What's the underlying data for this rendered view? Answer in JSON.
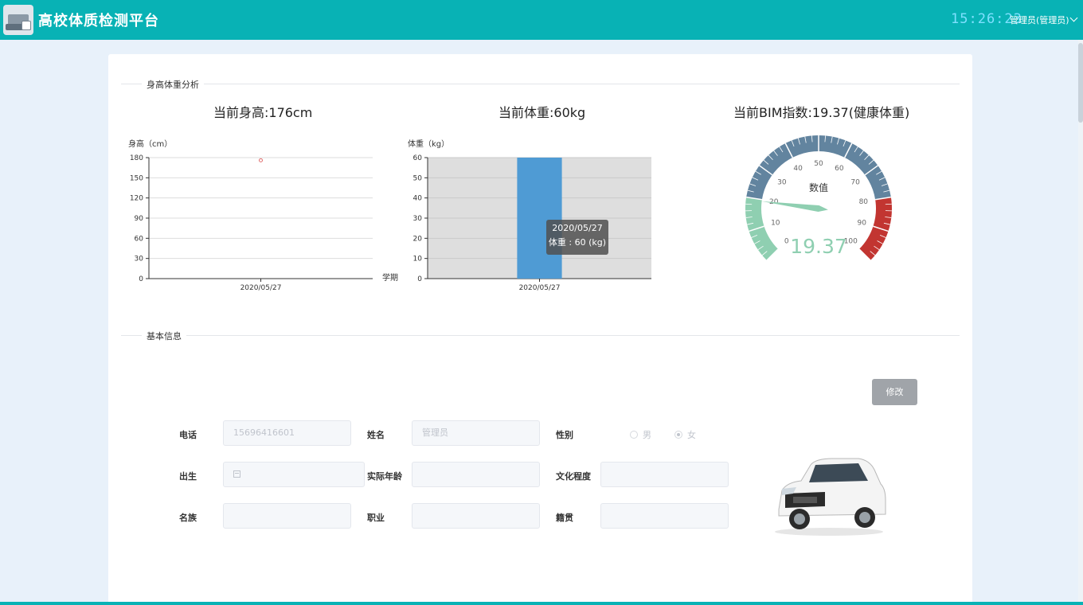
{
  "app": {
    "title": "高校体质检测平台",
    "clock": "15:26:23",
    "user": "管理员(管理员)"
  },
  "analysis": {
    "section_title": "身高体重分析",
    "height_label": "当前身高:176cm",
    "weight_label": "当前体重:60kg",
    "bmi_label": "当前BIM指数:19.37(健康体重)"
  },
  "chart_data": [
    {
      "type": "scatter",
      "ylabel": "身高（cm）",
      "categories": [
        "2020/05/27"
      ],
      "values": [
        176
      ],
      "ylim": [
        0,
        180
      ],
      "yticks": [
        "0",
        "30",
        "60",
        "90",
        "120",
        "150",
        "180"
      ],
      "xlabel": "学期",
      "grid": true
    },
    {
      "type": "bar",
      "ylabel": "体重（kg）",
      "categories": [
        "2020/05/27"
      ],
      "values": [
        60
      ],
      "ylim": [
        0,
        60
      ],
      "yticks": [
        "0",
        "10",
        "20",
        "30",
        "40",
        "50",
        "60"
      ],
      "grid": true,
      "tooltip": {
        "title": "2020/05/27",
        "line": "体重 : 60 (kg)"
      },
      "bar_color": "#4f9bd4"
    },
    {
      "type": "gauge",
      "title": "数值",
      "value": 19.37,
      "value_text": "19.37",
      "min": 0,
      "max": 100,
      "ticks": [
        "0",
        "10",
        "20",
        "30",
        "40",
        "50",
        "60",
        "70",
        "80",
        "90",
        "100"
      ],
      "bands": [
        {
          "to": 20,
          "color": "#8fcfb1"
        },
        {
          "to": 80,
          "color": "#62849f"
        },
        {
          "to": 100,
          "color": "#c23531"
        }
      ]
    }
  ],
  "basic_info": {
    "section_title": "基本信息",
    "edit_button": "修改",
    "fields": {
      "phone": {
        "label": "电话",
        "value": "15696416601"
      },
      "name": {
        "label": "姓名",
        "value": "管理员"
      },
      "gender": {
        "label": "性别",
        "options": [
          "男",
          "女"
        ],
        "selected": "女"
      },
      "birth": {
        "label": "出生",
        "value": ""
      },
      "age": {
        "label": "实际年龄",
        "value": ""
      },
      "education": {
        "label": "文化程度",
        "value": ""
      },
      "ethnicity": {
        "label": "名族",
        "value": ""
      },
      "job": {
        "label": "职业",
        "value": ""
      },
      "hometown": {
        "label": "籍贯",
        "value": ""
      }
    }
  },
  "colors": {
    "topbar": "#08b2b5",
    "clock": "#7ee0ff"
  }
}
